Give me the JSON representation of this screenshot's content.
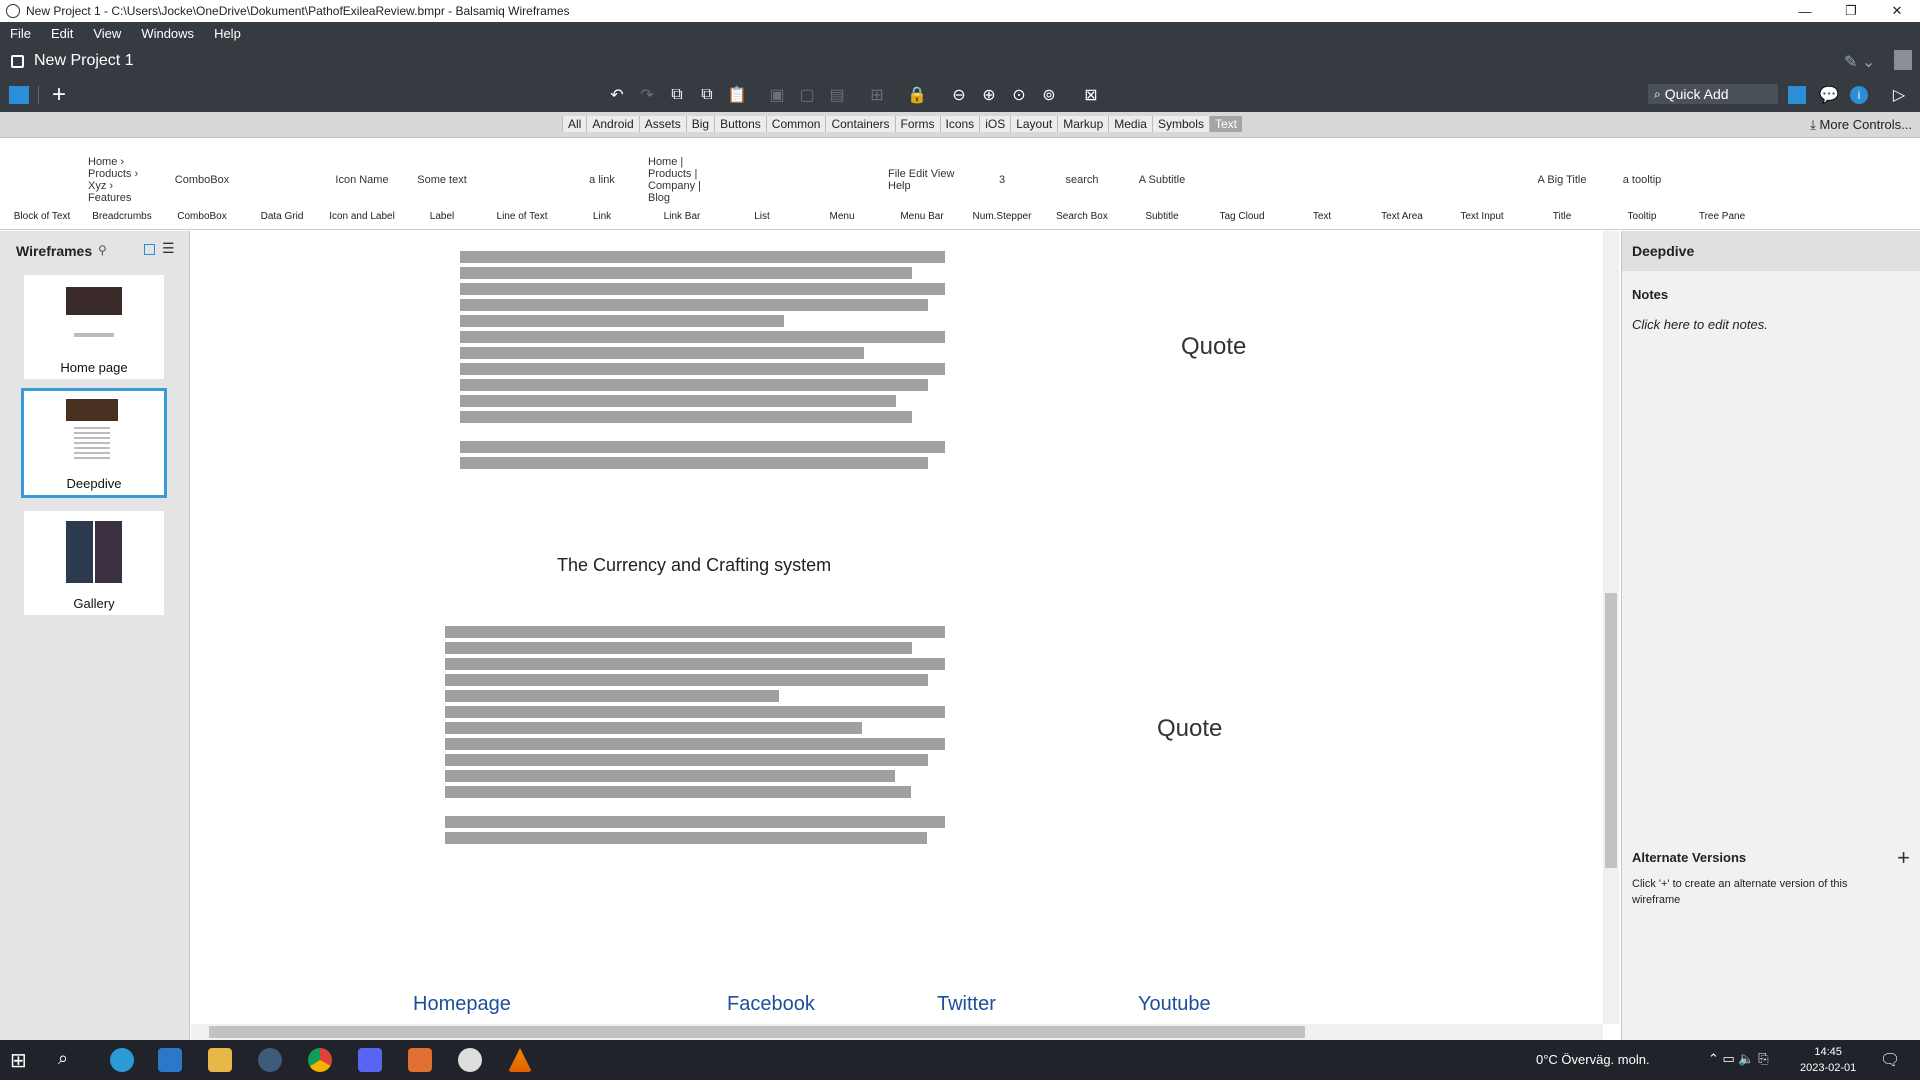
{
  "window": {
    "title": "New Project 1 - C:\\Users\\Jocke\\OneDrive\\Dokument\\PathofExileaReview.bmpr - Balsamiq Wireframes",
    "minimize": "—",
    "maximize": "❐",
    "close": "✕"
  },
  "menu": [
    "File",
    "Edit",
    "View",
    "Windows",
    "Help"
  ],
  "project": {
    "title": "New Project 1"
  },
  "quick_add": {
    "placeholder": "Quick Add"
  },
  "filter": {
    "categories": [
      "All",
      "Android",
      "Assets",
      "Big",
      "Buttons",
      "Common",
      "Containers",
      "Forms",
      "Icons",
      "iOS",
      "Layout",
      "Markup",
      "Media",
      "Symbols",
      "Text"
    ],
    "selected": "Text",
    "more_controls": "More Controls..."
  },
  "library": {
    "items": [
      {
        "label": "Block of Text",
        "preview": ""
      },
      {
        "label": "Breadcrumbs",
        "preview": "Home › Products › Xyz › Features"
      },
      {
        "label": "ComboBox",
        "preview": "ComboBox"
      },
      {
        "label": "Data Grid",
        "preview": ""
      },
      {
        "label": "Icon and Label",
        "preview": "Icon Name"
      },
      {
        "label": "Label",
        "preview": "Some text"
      },
      {
        "label": "Line of Text",
        "preview": ""
      },
      {
        "label": "Link",
        "preview": "a link"
      },
      {
        "label": "Link Bar",
        "preview": "Home | Products | Company | Blog"
      },
      {
        "label": "List",
        "preview": ""
      },
      {
        "label": "Menu",
        "preview": ""
      },
      {
        "label": "Menu Bar",
        "preview": "File  Edit  View  Help"
      },
      {
        "label": "Num.Stepper",
        "preview": "3"
      },
      {
        "label": "Search Box",
        "preview": "search"
      },
      {
        "label": "Subtitle",
        "preview": "A Subtitle"
      },
      {
        "label": "Tag Cloud",
        "preview": ""
      },
      {
        "label": "Text",
        "preview": ""
      },
      {
        "label": "Text Area",
        "preview": ""
      },
      {
        "label": "Text Input",
        "preview": ""
      },
      {
        "label": "Title",
        "preview": "A Big Title"
      },
      {
        "label": "Tooltip",
        "preview": "a tooltip"
      },
      {
        "label": "Tree Pane",
        "preview": ""
      }
    ]
  },
  "wireframes": {
    "header": "Wireframes",
    "pages": [
      {
        "name": "Home page"
      },
      {
        "name": "Deepdive"
      },
      {
        "name": "Gallery"
      }
    ],
    "selected": "Deepdive"
  },
  "canvas": {
    "section_heading": "The Currency and Crafting system",
    "quote1": "Quote",
    "quote2": "Quote",
    "footer_links": [
      "Homepage",
      "Facebook",
      "Twitter",
      "Youtube"
    ]
  },
  "properties": {
    "title": "Deepdive",
    "notes_heading": "Notes",
    "notes_placeholder": "Click here to edit notes.",
    "alt_heading": "Alternate Versions",
    "alt_text": "Click '+' to create an alternate version of this wireframe"
  },
  "taskbar": {
    "weather": "0°C  Överväg. moln.",
    "time": "14:45",
    "date": "2023-02-01"
  },
  "colors": {
    "chrome_dark": "#363b42",
    "accent": "#3a9bd9",
    "text_bar": "#a0a0a0",
    "link": "#1f4e9a"
  }
}
